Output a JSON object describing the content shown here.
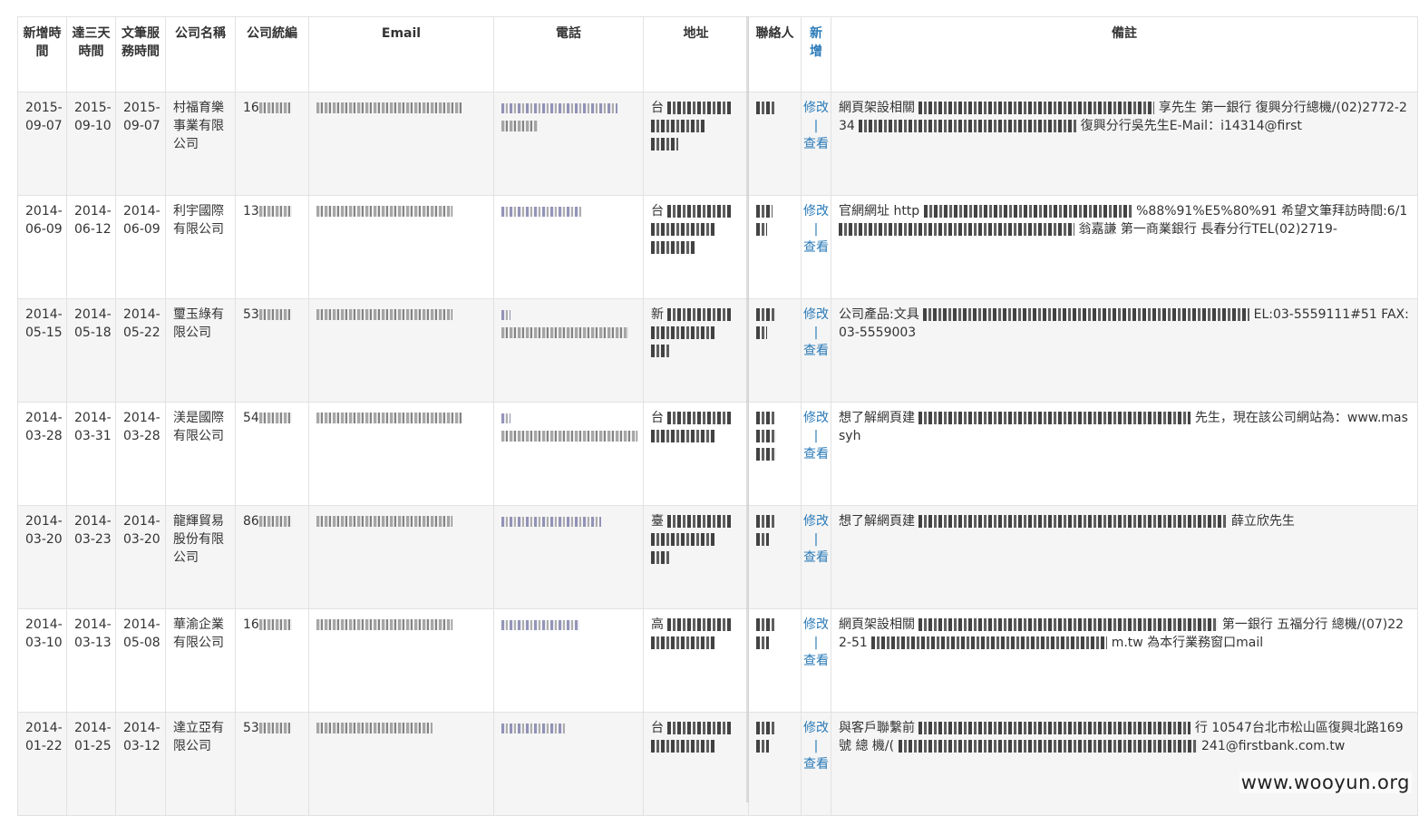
{
  "headers": [
    "新增時間",
    "達三天時間",
    "文筆服務時間",
    "公司名稱",
    "公司統編",
    "Email",
    "電話",
    "地址",
    "聯絡人",
    "新增",
    "備註"
  ],
  "action": {
    "edit": "修改",
    "sep": "|",
    "view": "查看"
  },
  "rows": [
    {
      "added": "2015-09-07",
      "three_days": "2015-09-10",
      "service": "2015-09-07",
      "company": "村福育樂事業有限公司",
      "tax_prefix": "16",
      "phone_text": "",
      "address_prefix": "台",
      "note_a": "網頁架設相關",
      "note_b": "享先生 第一銀行 復興分行總機/(02)2772-234",
      "note_c": "復興分行吳先生E-Mail：i14314@first"
    },
    {
      "added": "2014-06-09",
      "three_days": "2014-06-12",
      "service": "2014-06-09",
      "company": "利宇國際有限公司",
      "tax_prefix": "13",
      "phone_text": "",
      "address_prefix": "台",
      "note_a": "官網網址 http",
      "note_b": "%88%91%E5%80%91 希望文筆拜訪時間:6/1",
      "note_c": "翁嘉謙 第一商業銀行 長春分行TEL(02)2719-"
    },
    {
      "added": "2014-05-15",
      "three_days": "2014-05-18",
      "service": "2014-05-22",
      "company": "璽玉綠有限公司",
      "tax_prefix": "53",
      "phone_text": "",
      "address_prefix": "新",
      "note_a": "公司產品:文具",
      "note_b": "EL:03-5559111#51 FAX:03-5559003",
      "note_c": ""
    },
    {
      "added": "2014-03-28",
      "three_days": "2014-03-31",
      "service": "2014-03-28",
      "company": "渼是國際有限公司",
      "tax_prefix": "54",
      "phone_text": "",
      "address_prefix": "台",
      "note_a": "想了解網頁建",
      "note_b": "先生，現在該公司網站為：www.massyh",
      "note_c": ""
    },
    {
      "added": "2014-03-20",
      "three_days": "2014-03-23",
      "service": "2014-03-20",
      "company": "龍輝貿易股份有限公司",
      "tax_prefix": "86",
      "phone_text": "",
      "address_prefix": "臺",
      "note_a": "想了解網頁建",
      "note_b": "薛立欣先生",
      "note_c": ""
    },
    {
      "added": "2014-03-10",
      "three_days": "2014-03-13",
      "service": "2014-05-08",
      "company": "華渝企業有限公司",
      "tax_prefix": "16",
      "phone_text": "",
      "address_prefix": "高",
      "note_a": "網頁架設相關",
      "note_b": "第一銀行 五福分行 總機/(07)222-51",
      "note_c": "m.tw 為本行業務窗口mail"
    },
    {
      "added": "2014-01-22",
      "three_days": "2014-01-25",
      "service": "2014-03-12",
      "company": "達立亞有限公司",
      "tax_prefix": "53",
      "phone_text": "",
      "address_prefix": "台",
      "note_a": "與客戶聯繫前",
      "note_b": "行 10547台北市松山區復興北路169號 總 機/(",
      "note_c": "241@firstbank.com.tw"
    }
  ],
  "watermark": "www.wooyun.org"
}
